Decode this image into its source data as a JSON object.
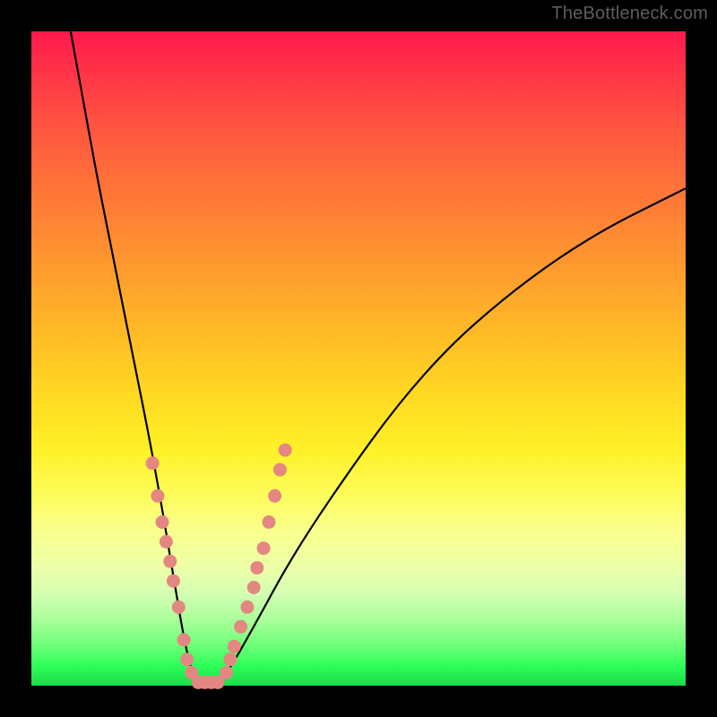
{
  "watermark": "TheBottleneck.com",
  "colors": {
    "background": "#000000",
    "gradient_top": "#ff1a4d",
    "gradient_mid": "#ffda22",
    "gradient_bottom": "#1bdc49",
    "curve": "#000000",
    "markers": "#e48782"
  },
  "chart_data": {
    "type": "line",
    "title": "",
    "xlabel": "",
    "ylabel": "",
    "xlim": [
      0,
      100
    ],
    "ylim": [
      0,
      100
    ],
    "series": [
      {
        "name": "bottleneck-curve",
        "x": [
          6,
          8,
          10,
          12,
          14,
          16,
          18,
          20,
          21,
          22,
          23,
          24,
          25,
          26,
          28,
          30,
          34,
          40,
          48,
          56,
          64,
          72,
          80,
          88,
          96,
          100
        ],
        "y": [
          100,
          89,
          78,
          68,
          58,
          48,
          38,
          27,
          21,
          15,
          9,
          4,
          1,
          0,
          0,
          2,
          9,
          20,
          32,
          43,
          52,
          59,
          65,
          70,
          74,
          76
        ]
      }
    ],
    "markers": {
      "name": "highlight-dots",
      "points": [
        {
          "x": 18.5,
          "y": 34
        },
        {
          "x": 19.3,
          "y": 29
        },
        {
          "x": 20.0,
          "y": 25
        },
        {
          "x": 20.6,
          "y": 22
        },
        {
          "x": 21.2,
          "y": 19
        },
        {
          "x": 21.7,
          "y": 16
        },
        {
          "x": 22.5,
          "y": 12
        },
        {
          "x": 23.3,
          "y": 7
        },
        {
          "x": 23.8,
          "y": 4
        },
        {
          "x": 24.5,
          "y": 2
        },
        {
          "x": 25.5,
          "y": 0.5
        },
        {
          "x": 26.5,
          "y": 0.5
        },
        {
          "x": 27.5,
          "y": 0.5
        },
        {
          "x": 28.5,
          "y": 0.5
        },
        {
          "x": 29.8,
          "y": 2
        },
        {
          "x": 30.4,
          "y": 4
        },
        {
          "x": 31.0,
          "y": 6
        },
        {
          "x": 32.0,
          "y": 9
        },
        {
          "x": 33.0,
          "y": 12
        },
        {
          "x": 34.0,
          "y": 15
        },
        {
          "x": 34.5,
          "y": 18
        },
        {
          "x": 35.5,
          "y": 21
        },
        {
          "x": 36.3,
          "y": 25
        },
        {
          "x": 37.2,
          "y": 29
        },
        {
          "x": 38.0,
          "y": 33
        },
        {
          "x": 38.8,
          "y": 36
        }
      ]
    }
  }
}
